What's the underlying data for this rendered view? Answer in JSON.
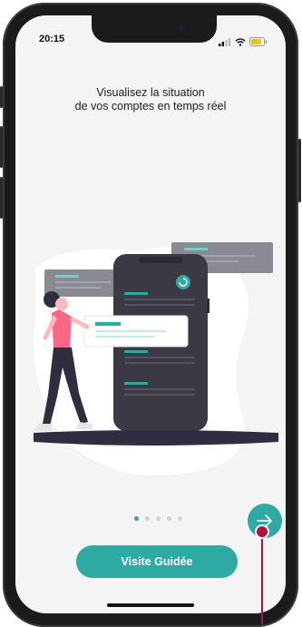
{
  "status_bar": {
    "time": "20:15"
  },
  "onboarding": {
    "title_line1": "Visualisez la situation",
    "title_line2": "de vos comptes en temps réel",
    "pagination": {
      "total": 5,
      "active_index": 0
    },
    "next_button_icon": "arrow-right-icon",
    "cta_label": "Visite Guidée"
  },
  "colors": {
    "accent": "#2ea9a3",
    "pointer": "#b0123f",
    "phone_frame": "#1b1b1d",
    "screen_bg": "#f4f4f4"
  }
}
